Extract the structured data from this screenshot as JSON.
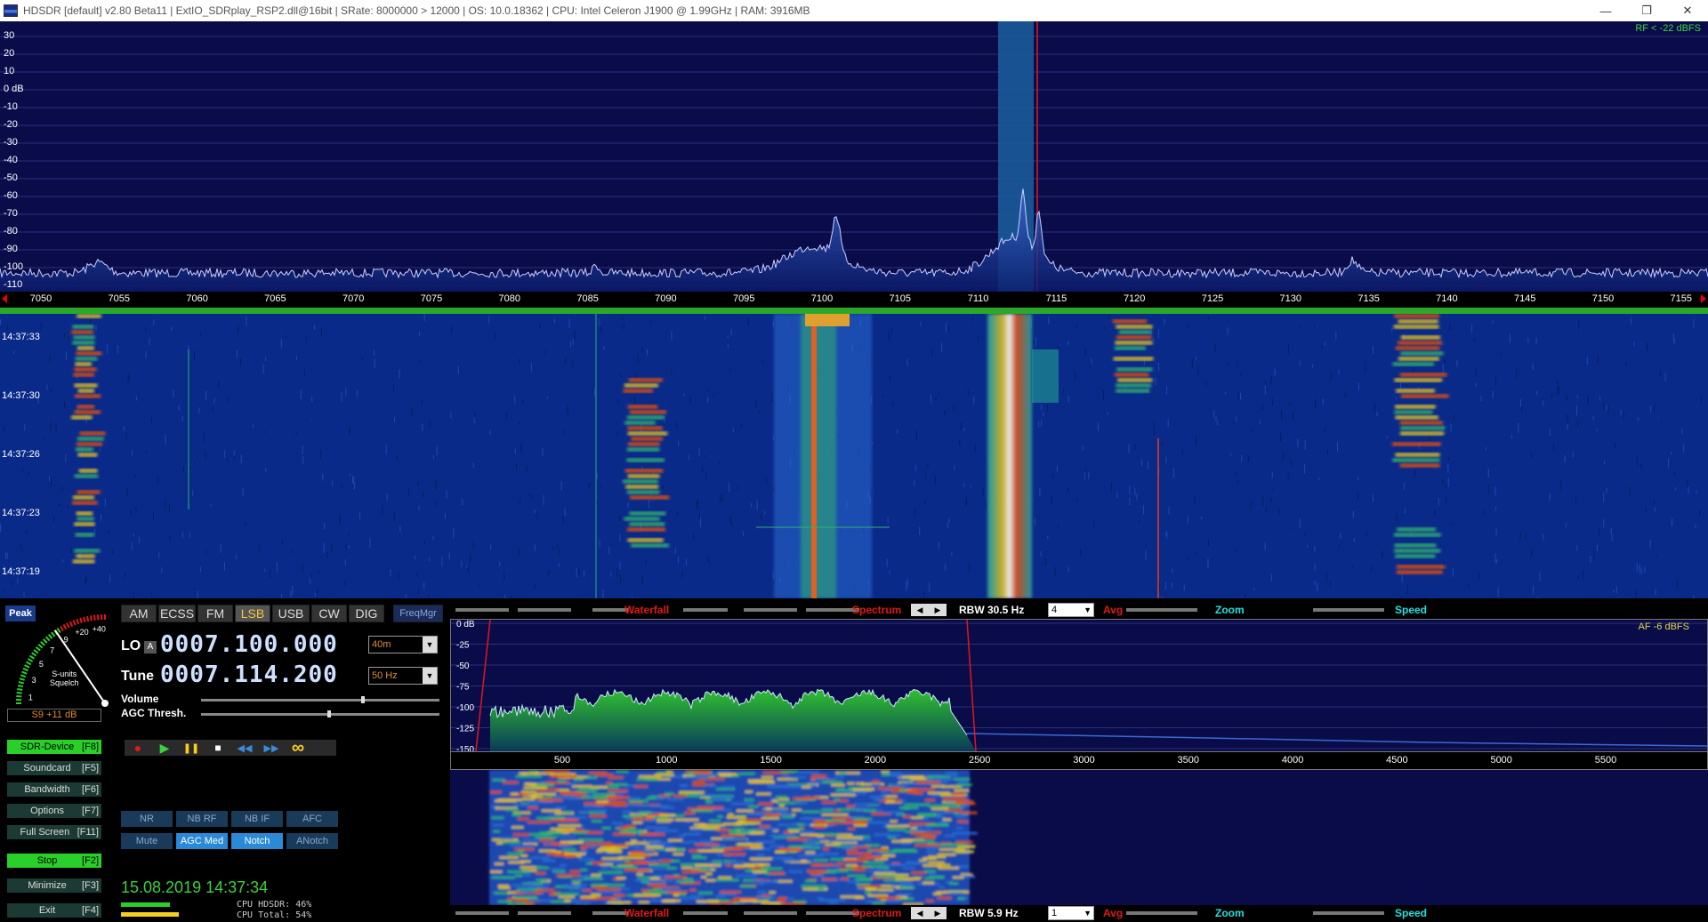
{
  "window": {
    "title": "HDSDR  [default]  v2.80 Beta11  |  ExtIO_SDRplay_RSP2.dll@16bit  |  SRate: 8000000 > 12000  |  OS: 10.0.18362  |  CPU: Intel Celeron  J1900  @ 1.99GHz  |  RAM: 3916MB",
    "minimize": "—",
    "restore": "❐",
    "close": "✕"
  },
  "rf_spectrum": {
    "level": "RF < -22 dBFS",
    "db_labels": [
      "30",
      "20",
      "10",
      "0 dB",
      "-10",
      "-20",
      "-30",
      "-40",
      "-50",
      "-60",
      "-70",
      "-80",
      "-90",
      "-100",
      "-110"
    ],
    "freq_labels": [
      "7050",
      "7055",
      "7060",
      "7065",
      "7070",
      "7075",
      "7080",
      "7085",
      "7090",
      "7095",
      "7100",
      "7105",
      "7110",
      "7115",
      "7120",
      "7125",
      "7130",
      "7135",
      "7140",
      "7145",
      "7150",
      "7155"
    ]
  },
  "waterfall": {
    "timestamps": [
      "14:37:33",
      "14:37:30",
      "14:37:26",
      "14:37:23",
      "14:37:19"
    ]
  },
  "smeter": {
    "peak": "Peak",
    "scale": [
      "1",
      "3",
      "5",
      "7",
      "9",
      "+20",
      "+40"
    ],
    "label_line1": "S-units",
    "label_line2": "Squelch",
    "value": "S9 +11 dB"
  },
  "modes": {
    "items": [
      "AM",
      "ECSS",
      "FM",
      "LSB",
      "USB",
      "CW",
      "DIG"
    ],
    "active": "LSB",
    "freqmgr": "FreqMgr"
  },
  "lo": {
    "label": "LO",
    "a": "A",
    "digits": "0007.100.000",
    "band": "40m"
  },
  "tune": {
    "label": "Tune",
    "digits": "0007.114.200",
    "step": "50 Hz"
  },
  "sliders": {
    "volume": "Volume",
    "agc_thresh": "AGC Thresh.",
    "volume_level": 0.67,
    "agc_level": 0.53
  },
  "side_buttons": [
    {
      "name": "SDR-Device",
      "key": "[F8]"
    },
    {
      "name": "Soundcard",
      "key": "[F5]"
    },
    {
      "name": "Bandwidth",
      "key": "[F6]"
    },
    {
      "name": "Options",
      "key": "[F7]"
    },
    {
      "name": "Full Screen",
      "key": "[F11]"
    },
    {
      "name": "Stop",
      "key": "[F2]"
    },
    {
      "name": "Minimize",
      "key": "[F3]"
    },
    {
      "name": "Exit",
      "key": "[F4]"
    }
  ],
  "transport": {
    "record": "●",
    "play": "▶",
    "pause": "❚❚",
    "stop": "■",
    "rewind": "◀◀",
    "forward": "▶▶",
    "loop": "∞"
  },
  "dsp": {
    "nr": "NR",
    "nb_rf": "NB RF",
    "nb_if": "NB IF",
    "afc": "AFC",
    "mute": "Mute",
    "agc_med": "AGC Med",
    "notch": "Notch",
    "anotch": "ANotch"
  },
  "status": {
    "datetime": "15.08.2019 14:37:34",
    "cpu_hdsdr": "CPU HDSDR:  46%",
    "cpu_total": "CPU Total:  54%",
    "cpu_hdsdr_level": 0.46,
    "cpu_total_level": 0.54
  },
  "ctrl_top": {
    "waterfall": "Waterfall",
    "spectrum": "Spectrum",
    "rbw": "RBW  30.5 Hz",
    "avg_value": "4",
    "avg": "Avg",
    "zoom": "Zoom",
    "speed": "Speed"
  },
  "ctrl_bottom": {
    "waterfall": "Waterfall",
    "spectrum": "Spectrum",
    "rbw": "RBW   5.9 Hz",
    "avg_value": "1",
    "avg": "Avg",
    "zoom": "Zoom",
    "speed": "Speed"
  },
  "af_spectrum": {
    "level": "AF  -6 dBFS",
    "db_labels": [
      "0 dB",
      "-25",
      "-50",
      "-75",
      "-100",
      "-125",
      "-150"
    ],
    "freq_labels": [
      "500",
      "1000",
      "1500",
      "2000",
      "2500",
      "3000",
      "3500",
      "4000",
      "4500",
      "5000",
      "5500"
    ]
  },
  "colors": {
    "spectrum_bg": "#0a0c4a",
    "waterfall_bg": "#0a2a8a",
    "accent_green": "#3cd23c",
    "accent_red": "#e01818",
    "accent_cyan": "#20e0e0",
    "freq_digits": "#cfe0ff"
  }
}
